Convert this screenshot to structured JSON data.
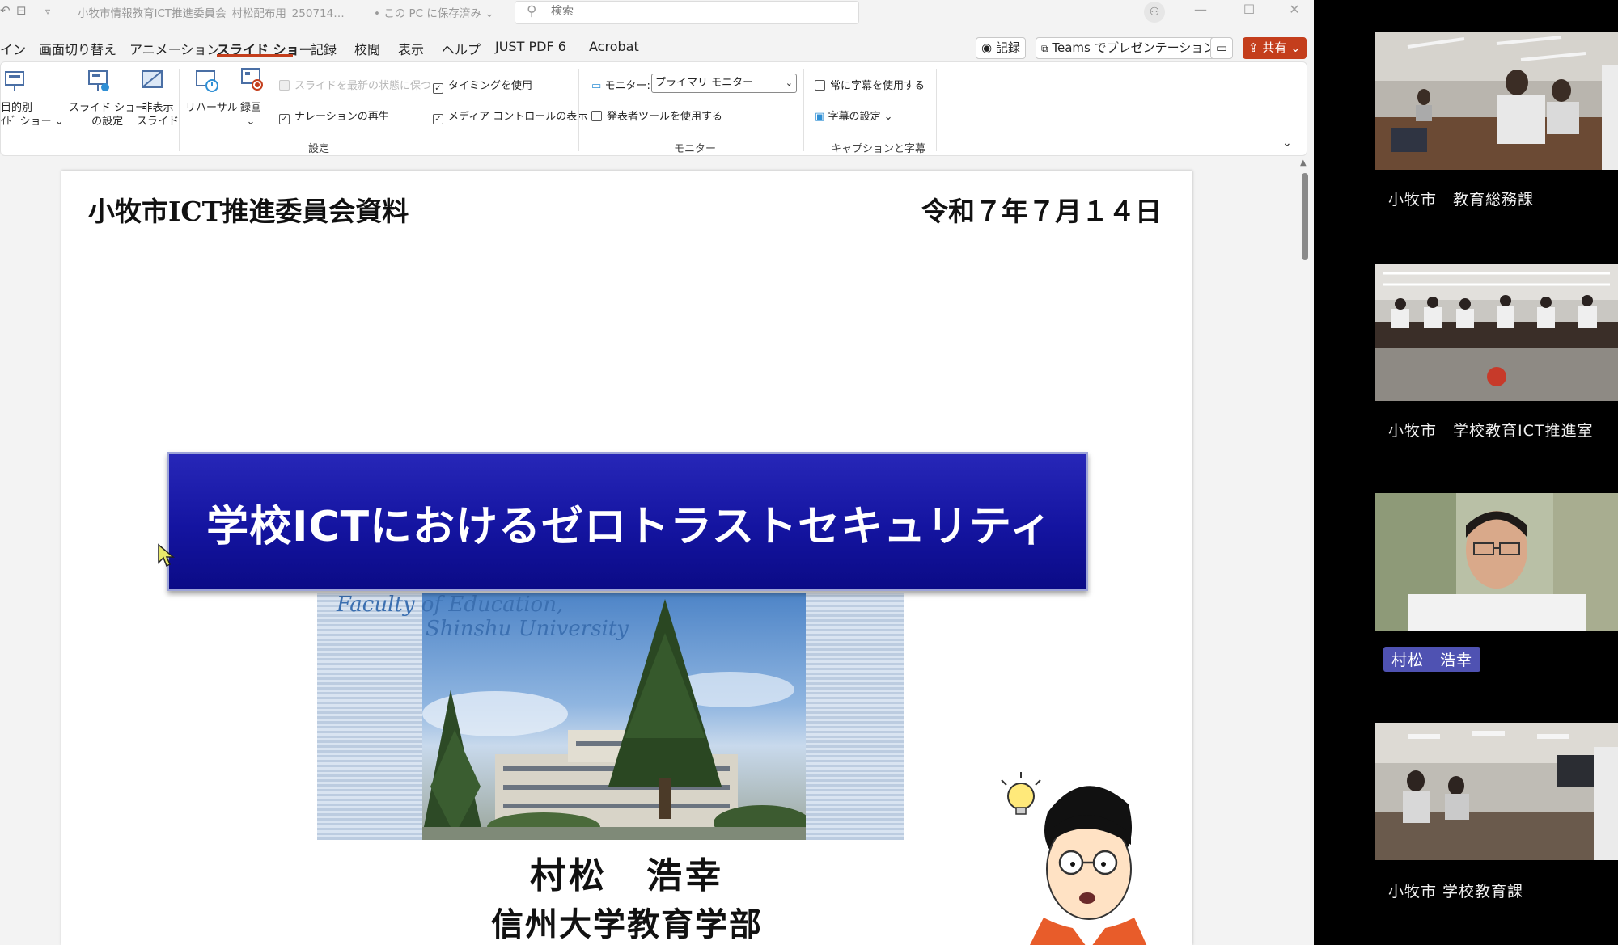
{
  "titlebar": {
    "document_title": "小牧市情報教育ICT推進委員会_村松配布用_250714…",
    "save_status": "• この PC に保存済み ⌄",
    "search_placeholder": "検索"
  },
  "ribbon_tabs": [
    "イン",
    "画面切り替え",
    "アニメーション",
    "スライド ショー",
    "記録",
    "校閲",
    "表示",
    "ヘルプ",
    "JUST PDF 6",
    "Acrobat"
  ],
  "header_buttons": {
    "record": "◉ 記録",
    "teams_present": "Teams でプレゼンテーション",
    "comment_icon": "comment-icon",
    "share": "共有 ⌄"
  },
  "ribbon": {
    "custom_show_line1": "目的別",
    "custom_show_line2": "ｲﾄﾞ ショー ⌄",
    "setup_line1": "スライド ショー",
    "setup_line2": "の設定",
    "hide_line1": "非表示",
    "hide_line2": "スライド",
    "rehearse": "リハーサル",
    "record_label": "録画",
    "record_arrow": "⌄",
    "keep_updated": "スライドを最新の状態に保つ",
    "play_narration": "ナレーションの再生",
    "use_timings": "タイミングを使用",
    "show_media_controls": "メディア コントロールの表示",
    "setup_group": "設定",
    "monitor_label": "モニター:",
    "monitor_value": "プライマリ モニター",
    "presenter_view": "発表者ツールを使用する",
    "monitors_group": "モニター",
    "always_subtitles": "常に字幕を使用する",
    "subtitle_settings": "字幕の設定 ⌄",
    "captions_group": "キャプションと字幕"
  },
  "slide": {
    "header_left": "小牧市ICT推進委員会資料",
    "header_right": "令和７年７月１４日",
    "title": "学校ICTにおけるゼロトラストセキュリティ",
    "photo_caption_line1": "Faculty of Education,",
    "photo_caption_line2": "Shinshu University",
    "presenter_name": "村松　浩幸",
    "affiliation": "信州大学教育学部"
  },
  "participants": [
    {
      "name": "小牧市　教育総務課",
      "active": false
    },
    {
      "name": "小牧市　学校教育ICT推進室",
      "active": false
    },
    {
      "name": "村松　浩幸",
      "active": true
    },
    {
      "name": "小牧市 学校教育課",
      "active": false
    }
  ],
  "colors": {
    "accent": "#c43e1c",
    "title_banner": "#1414a0",
    "speaker_highlight": "#4f52b2"
  }
}
